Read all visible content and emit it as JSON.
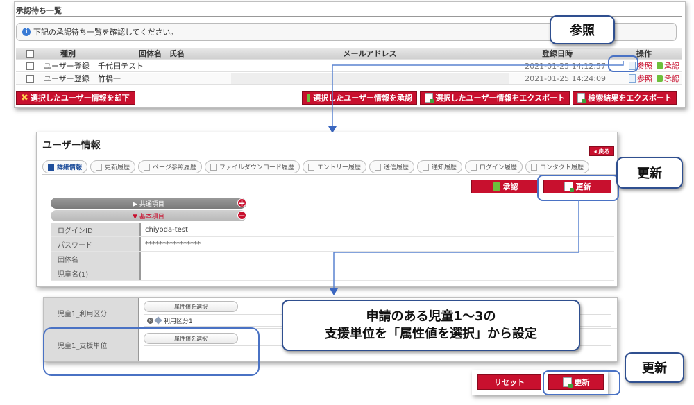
{
  "approval": {
    "title": "承認待ち一覧",
    "notice": "下記の承認待ち一覧を確認してください。",
    "columns": [
      "種別",
      "回体名　氏名",
      "メールアドレス",
      "登録日時",
      "操作"
    ],
    "rows": [
      {
        "type": "ユーザー登録",
        "name": "千代田テスト",
        "email": "",
        "date": "2021-01-25 14:12:57",
        "view": "参照",
        "approve": "承認"
      },
      {
        "type": "ユーザー登録",
        "name": "竹橋一",
        "email": "",
        "date": "2021-01-25 14:24:09",
        "view": "参照",
        "approve": "承認"
      }
    ],
    "reject_label": "選択したユーザー情報を却下",
    "approve_selected_label": "選択したユーザー情報を承認",
    "export_selected_label": "選択したユーザー情報をエクスポート",
    "export_results_label": "検索結果をエクスポート"
  },
  "user_info": {
    "title": "ユーザー情報",
    "back_label": "◂ 戻る",
    "tabs": [
      "詳細情報",
      "更新履歴",
      "ページ参照履歴",
      "ファイルダウンロード履歴",
      "エントリー履歴",
      "送信履歴",
      "通知履歴",
      "ログイン履歴",
      "コンタクト履歴"
    ],
    "approve_label": "承認",
    "update_label": "更新",
    "common_section": "▶ 共通項目",
    "basic_section": "▼ 基本項目",
    "plus": "+",
    "minus": "−",
    "fields": [
      {
        "label": "ログインID",
        "value": "chiyoda-test"
      },
      {
        "label": "パスワード",
        "value": "****************"
      },
      {
        "label": "団体名",
        "value": ""
      },
      {
        "label": "児童名(1)",
        "value": ""
      }
    ]
  },
  "attr": {
    "row1_label": "児童1_利用区分",
    "row2_label": "児童1_支援単位",
    "select_label": "属性値を選択",
    "tag_value": "利用区分1"
  },
  "bottom": {
    "reset_label": "リセット",
    "update_label": "更新"
  },
  "callouts": {
    "view": "参照",
    "update1": "更新",
    "update2": "更新",
    "note_line1": "申請のある児童1～3の",
    "note_line2": "支援単位を「属性値を選択」から設定"
  },
  "colors": {
    "accent_red": "#c8102e",
    "callout_blue": "#2f4f8f",
    "highlight_blue": "#4a72c4"
  }
}
